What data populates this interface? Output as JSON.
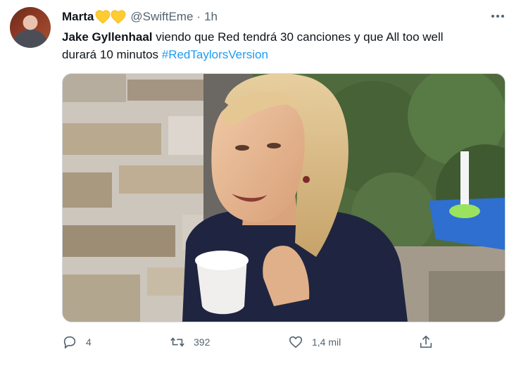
{
  "tweet": {
    "author": {
      "display_name": "Marta",
      "handle": "@SwiftEme",
      "separator": "·",
      "time": "1h"
    },
    "text": {
      "bold": "Jake Gyllenhaal",
      "line1_rest": " viendo que Red tendrá 30 canciones y que All too well",
      "line2": "durará 10 minutos ",
      "hashtag": "#RedTaylorsVersion"
    },
    "actions": {
      "replies": "4",
      "retweets": "392",
      "likes": "1,4 mil"
    },
    "icons": {
      "hearts": "yellow-heart-emoji",
      "more": "more-dots-icon",
      "reply": "reply-icon",
      "retweet": "retweet-icon",
      "like": "like-icon",
      "share": "share-icon"
    },
    "colors": {
      "hashtag": "#1d9bf0",
      "secondary_text": "#536471",
      "heart": "#ffcc33"
    }
  }
}
